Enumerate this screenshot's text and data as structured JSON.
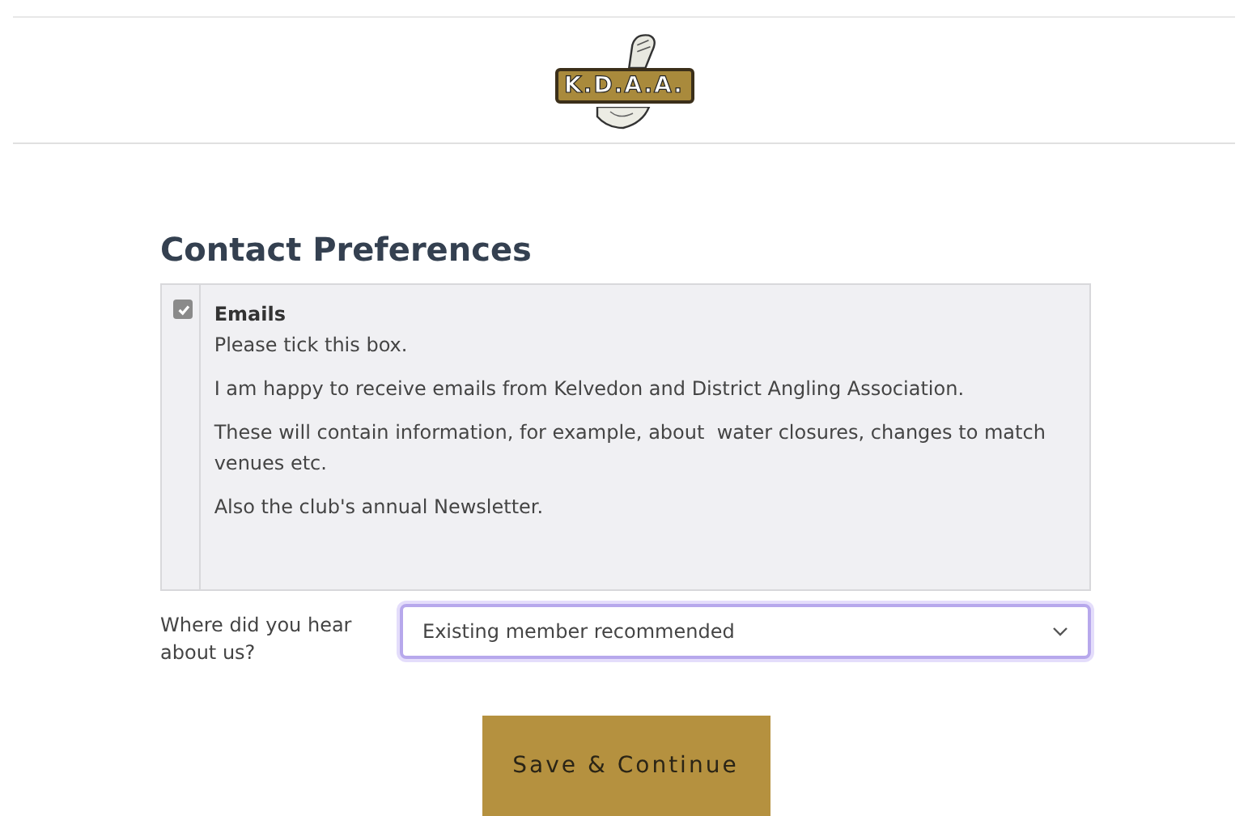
{
  "header": {
    "logo_text": "K.D.A.A."
  },
  "section": {
    "title": "Contact Preferences",
    "consent": {
      "checked": true,
      "label": "Emails",
      "paragraphs": [
        "Please tick this box.",
        "I am happy to receive emails from Kelvedon and District Angling Association.",
        "These will contain information, for example, about  water closures, changes to match venues etc.",
        "Also the club's annual Newsletter."
      ]
    },
    "referral": {
      "label": "Where did you hear about us?",
      "value": "Existing member recommended",
      "focused": true
    }
  },
  "buttons": [
    {
      "label": "Save & Continue"
    }
  ]
}
